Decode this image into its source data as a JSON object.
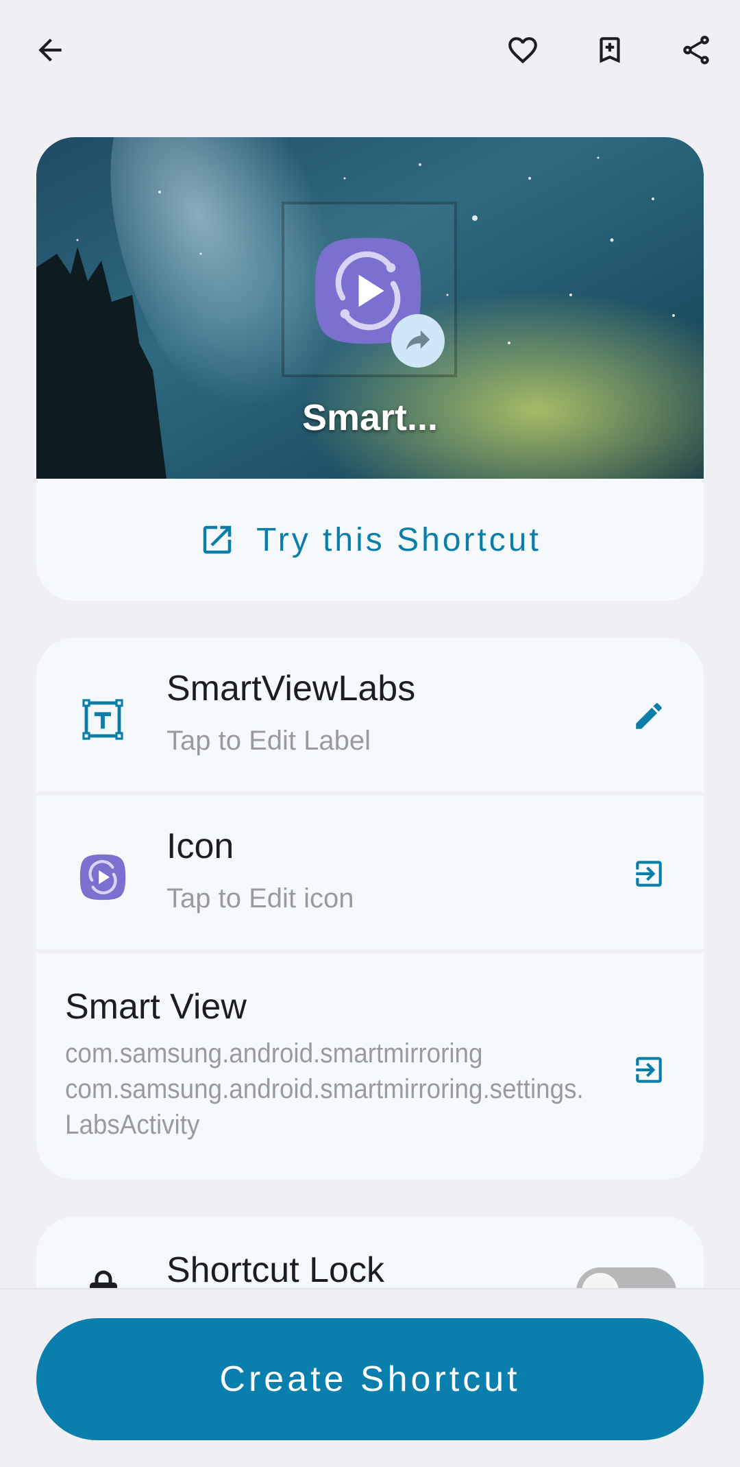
{
  "topbar": {
    "back_icon": "arrow-back-icon",
    "favorite_icon": "heart-outline-icon",
    "bookmark_icon": "bookmark-add-icon",
    "share_icon": "share-icon"
  },
  "preview": {
    "name": "Smart...",
    "try_label": "Try this Shortcut",
    "accent_color": "#0a7ea8",
    "app_icon_color": "#7b6fcf"
  },
  "info": {
    "label_row": {
      "title": "SmartViewLabs",
      "subtitle": "Tap to Edit Label"
    },
    "icon_row": {
      "title": "Icon",
      "subtitle": "Tap to Edit icon"
    },
    "app_row": {
      "title": "Smart View",
      "package": "com.samsung.android.smartmirroring",
      "activity": "com.samsung.android.smartmirroring.settings.LabsActivity"
    }
  },
  "lock": {
    "title": "Shortcut Lock",
    "toggle_on": false
  },
  "footer": {
    "create_label": "Create Shortcut",
    "button_color": "#0a7fae"
  }
}
